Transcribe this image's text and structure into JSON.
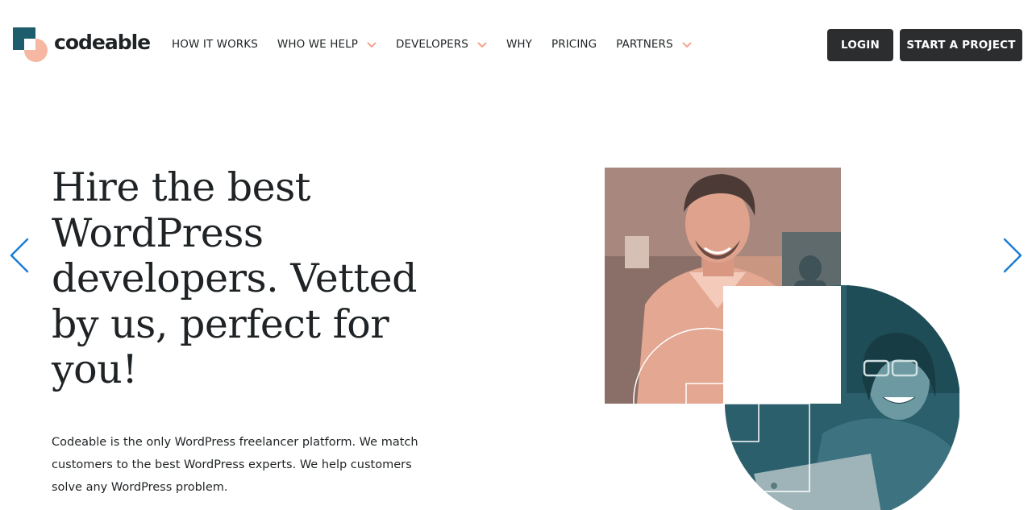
{
  "brand": {
    "name": "codeable",
    "colors": {
      "teal": "#1e5e6c",
      "peach": "#f6b7a3",
      "dark": "#2b2d2f",
      "arrow_blue": "#1a7fd6"
    }
  },
  "nav": {
    "items": [
      {
        "label": "HOW IT WORKS",
        "has_dropdown": false
      },
      {
        "label": "WHO WE HELP",
        "has_dropdown": true
      },
      {
        "label": "DEVELOPERS",
        "has_dropdown": true
      },
      {
        "label": "WHY",
        "has_dropdown": false
      },
      {
        "label": "PRICING",
        "has_dropdown": false
      },
      {
        "label": "PARTNERS",
        "has_dropdown": true
      }
    ],
    "dropdown_icon": "chevron-down-icon"
  },
  "header_actions": {
    "login_label": "LOGIN",
    "start_label": "START A PROJECT"
  },
  "hero": {
    "title_lines": [
      "Hire the best",
      "WordPress",
      "developers. Vetted",
      "by us, perfect for",
      "you!"
    ],
    "description": "Codeable is the only WordPress freelancer platform. We match customers to the best WordPress experts. We help customers solve any WordPress problem.",
    "prev_icon": "chevron-left-icon",
    "next_icon": "chevron-right-icon"
  }
}
